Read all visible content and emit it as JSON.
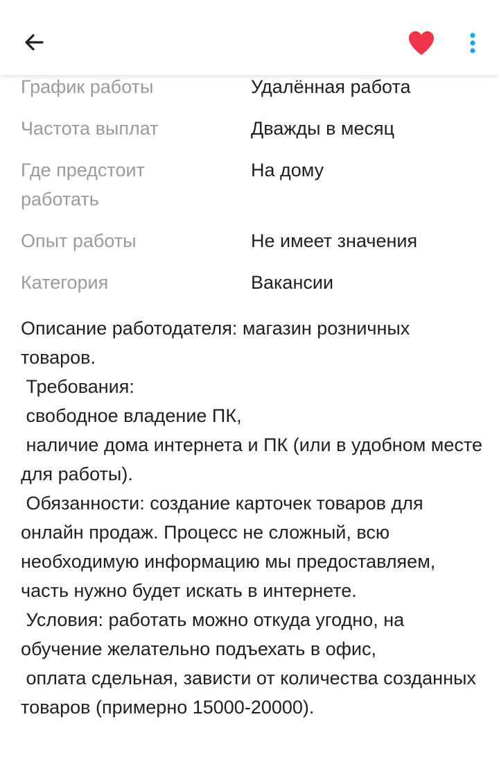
{
  "header": {
    "back_icon": "arrow-left-icon",
    "favorite_icon": "heart-icon",
    "favorite_color": "#f0344b",
    "more_icon": "more-vertical-icon",
    "more_color": "#1aa3e8"
  },
  "details": [
    {
      "label": "График работы",
      "value": "Удалённая работа"
    },
    {
      "label": "Частота выплат",
      "value": "Дважды в месяц"
    },
    {
      "label": "Где предстоит работать",
      "value": "На дому"
    },
    {
      "label": "Опыт работы",
      "value": "Не имеет значения"
    },
    {
      "label": "Категория",
      "value": "Вакансии"
    }
  ],
  "description": "Описание работодателя: магазин розничных товаров.\n Требования:\n свободное владение ПК,\n наличие дома интернета и ПК (или в удобном месте для работы).\n Обязанности: создание карточек товаров для онлайн продаж. Процесс не сложный, всю необходимую информацию мы предоставляем, часть нужно будет искать в интернете.\n Условия: работать можно откуда угодно, на обучение желательно подъехать в офис,\n оплата сдельная, зависти от количества созданных товаров (примерно 15000-20000)."
}
